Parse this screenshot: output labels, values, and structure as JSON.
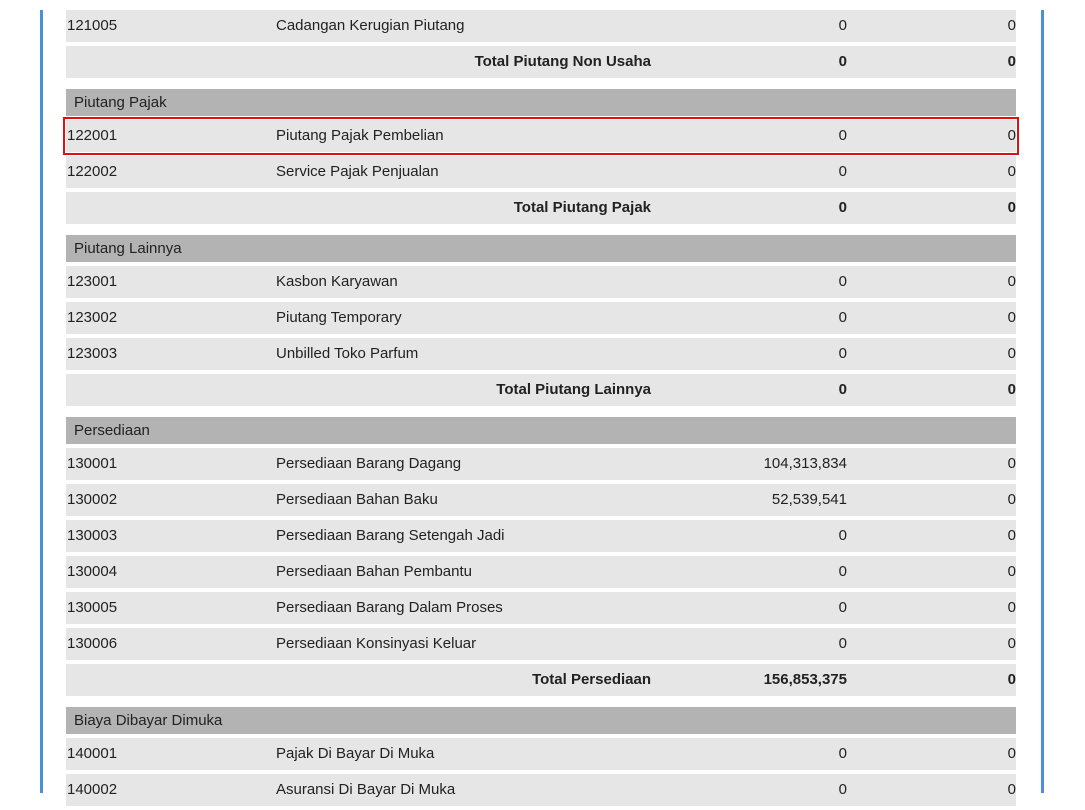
{
  "table": {
    "rows": [
      {
        "type": "item",
        "code": "121005",
        "name": "Cadangan Kerugian Piutang",
        "amount1": "0",
        "amount2": "0"
      },
      {
        "type": "total",
        "label": "Total Piutang Non Usaha",
        "amount1": "0",
        "amount2": "0"
      },
      {
        "type": "header",
        "label": "Piutang Pajak"
      },
      {
        "type": "item",
        "code": "122001",
        "name": "Piutang Pajak Pembelian",
        "amount1": "0",
        "amount2": "0",
        "highlighted": true
      },
      {
        "type": "item",
        "code": "122002",
        "name": "Service Pajak Penjualan",
        "amount1": "0",
        "amount2": "0"
      },
      {
        "type": "total",
        "label": "Total Piutang Pajak",
        "amount1": "0",
        "amount2": "0"
      },
      {
        "type": "header",
        "label": "Piutang Lainnya"
      },
      {
        "type": "item",
        "code": "123001",
        "name": "Kasbon Karyawan",
        "amount1": "0",
        "amount2": "0"
      },
      {
        "type": "item",
        "code": "123002",
        "name": "Piutang Temporary",
        "amount1": "0",
        "amount2": "0"
      },
      {
        "type": "item",
        "code": "123003",
        "name": "Unbilled Toko Parfum",
        "amount1": "0",
        "amount2": "0"
      },
      {
        "type": "total",
        "label": "Total Piutang Lainnya",
        "amount1": "0",
        "amount2": "0"
      },
      {
        "type": "header",
        "label": "Persediaan"
      },
      {
        "type": "item",
        "code": "130001",
        "name": "Persediaan Barang Dagang",
        "amount1": "104,313,834",
        "amount2": "0"
      },
      {
        "type": "item",
        "code": "130002",
        "name": "Persediaan Bahan Baku",
        "amount1": "52,539,541",
        "amount2": "0"
      },
      {
        "type": "item",
        "code": "130003",
        "name": "Persediaan Barang Setengah Jadi",
        "amount1": "0",
        "amount2": "0"
      },
      {
        "type": "item",
        "code": "130004",
        "name": "Persediaan Bahan Pembantu",
        "amount1": "0",
        "amount2": "0"
      },
      {
        "type": "item",
        "code": "130005",
        "name": "Persediaan Barang Dalam Proses",
        "amount1": "0",
        "amount2": "0"
      },
      {
        "type": "item",
        "code": "130006",
        "name": "Persediaan Konsinyasi Keluar",
        "amount1": "0",
        "amount2": "0"
      },
      {
        "type": "total",
        "label": "Total Persediaan",
        "amount1": "156,853,375",
        "amount2": "0"
      },
      {
        "type": "header",
        "label": "Biaya Dibayar Dimuka"
      },
      {
        "type": "item",
        "code": "140001",
        "name": "Pajak Di Bayar Di Muka",
        "amount1": "0",
        "amount2": "0"
      },
      {
        "type": "item",
        "code": "140002",
        "name": "Asuransi Di Bayar Di Muka",
        "amount1": "0",
        "amount2": "0"
      }
    ]
  },
  "colors": {
    "row_bg": "#e6e6e6",
    "header_bg": "#b3b3b3",
    "highlight_border": "#e01010",
    "frame_line": "#4a90d9"
  }
}
